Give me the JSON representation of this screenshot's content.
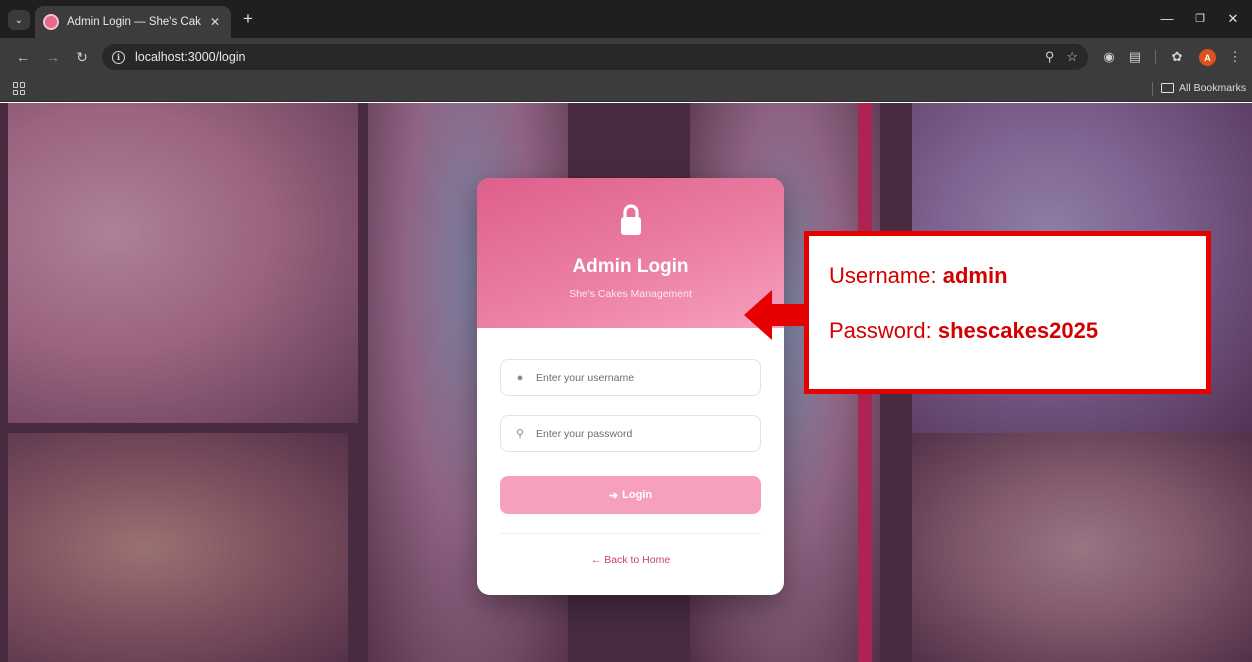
{
  "browser": {
    "tab_title": "Admin Login — She's Cakes",
    "url": "localhost:3000/login",
    "profile_initial": "A",
    "bookmarks_label": "All Bookmarks",
    "colors": {
      "frame": "#1f1f1f",
      "toolbar": "#3c3c3c",
      "profile": "#d9531e"
    }
  },
  "login_card": {
    "title": "Admin Login",
    "subtitle": "She's Cakes Management",
    "username_placeholder": "Enter your username",
    "password_placeholder": "Enter your password",
    "login_label": "Login",
    "back_label": "Back to Home",
    "colors": {
      "header_start": "#de5f8b",
      "header_end": "#f7a0bf",
      "button": "#f6a0bd",
      "link": "#c9436f"
    }
  },
  "annotation": {
    "username_label": "Username:",
    "username_value": "admin",
    "password_label": "Password:",
    "password_value": "shescakes2025",
    "color": "#e60000"
  }
}
